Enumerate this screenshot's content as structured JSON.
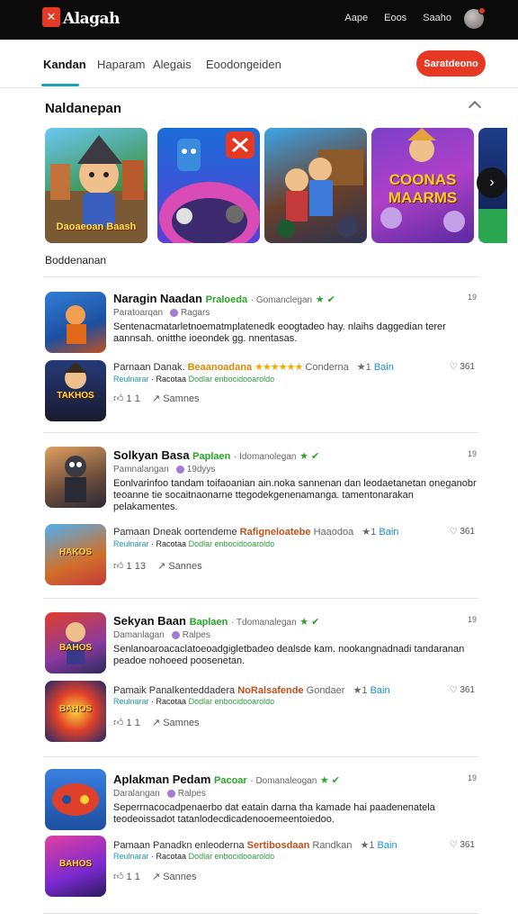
{
  "header": {
    "brand": "Alagah",
    "nav": [
      "Aape",
      "Eoos",
      "Saaho"
    ]
  },
  "tabs": [
    {
      "label": "Kandan"
    },
    {
      "label": "Haparam"
    },
    {
      "label": "Alegais"
    },
    {
      "label": "Eoodongeiden"
    }
  ],
  "cta_label": "Saratdeono",
  "featured": {
    "title": "Naldanepan",
    "tiles": [
      "Daoaeoan Baash",
      "",
      "",
      "COONAS MAARMS",
      ""
    ]
  },
  "list_section_title": "Boddenanan",
  "cards": [
    {
      "title": "Naragin Naadan",
      "badge": "Praloeda",
      "meta": "Gomanclegan",
      "num": "19",
      "author": "Paratoarqan",
      "tag": "Ragars",
      "desc": "Sentenacmatarletnoematmplatenedk eoogtadeo hay. nlaihs daggedian terer aannsah. onitthe ioeondek gg. nnentasas.",
      "sub_title": "Parnaan Danak.",
      "sub_rating": "Beaanoadana",
      "sub_label": "Conderna",
      "sub_score": "Bain",
      "sub_count": "1",
      "sub_right": "361",
      "tags_a": "Reulnarar",
      "tags_b": "Racotaa",
      "tags_c": "Dodlar enbocidooaroldo",
      "likes": "1",
      "shares": "Samnes",
      "thumb_text": "TAKHOS"
    },
    {
      "title": "Solkyan Basa",
      "badge": "Paplaen",
      "meta": "Idomanolegan",
      "num": "19",
      "author": "Pamnalangan",
      "tag": "19dyys",
      "desc": "Eonlvarinfoo tandam toifaoanian ain.noka sannenan dan leodaetanetan oneganobr teoanne tie socaitnaonarne ttegodekgenenamanga. tamentonarakan pelakamentes.",
      "sub_title": "Pamaan Dneak oortendeme",
      "sub_rating": "Rafigneloatebe",
      "sub_label": "Haaodoa",
      "sub_score": "Bain",
      "sub_count": "1",
      "sub_right": "361",
      "tags_a": "Reulnarar",
      "tags_b": "Racotaa",
      "tags_c": "Dodlar enbocidooaroldo",
      "likes": "13",
      "shares": "Sannes",
      "thumb_text": "HAKOS"
    },
    {
      "title": "Sekyan Baan",
      "badge": "Baplaen",
      "meta": "Tdomanalegan",
      "num": "19",
      "author": "Damanlagan",
      "tag": "Ralpes",
      "desc": "Senlanoaroacaclatoeoadgigletbadeo dealsde kam. nookangnadnadi tandaranan peadoe nohoeed poosenetan.",
      "sub_title": "Pamaik Panalkenteddadera",
      "sub_rating": "NoRalsafende",
      "sub_label": "Gondaer",
      "sub_score": "Bain",
      "sub_count": "1",
      "sub_right": "361",
      "tags_a": "Reulnarar",
      "tags_b": "Racotaa",
      "tags_c": "Dodlar enbocidooaroldo",
      "likes": "1",
      "shares": "Samnes",
      "thumb_text": "BAHOS"
    },
    {
      "title": "Aplakman Pedam",
      "badge": "Pacoar",
      "meta": "Domanaleogan",
      "num": "19",
      "author": "Daralangan",
      "tag": "Ralpes",
      "desc": "Seperrnacocadpenaerbo dat eatain darna tha kamade hai paadenenatela teodeoissadot tatanlodecdicadenooemeentoiedoo.",
      "sub_title": "Pamaan Panadkn enleoderna",
      "sub_rating": "Sertibosdaan",
      "sub_label": "Randkan",
      "sub_score": "Bain",
      "sub_count": "1",
      "sub_right": "361",
      "tags_a": "Reulnarar",
      "tags_b": "Racotaa",
      "tags_c": "Dodlar enbocidooaroldo",
      "likes": "1",
      "shares": "Sannes",
      "thumb_text": "BAHOS"
    }
  ]
}
